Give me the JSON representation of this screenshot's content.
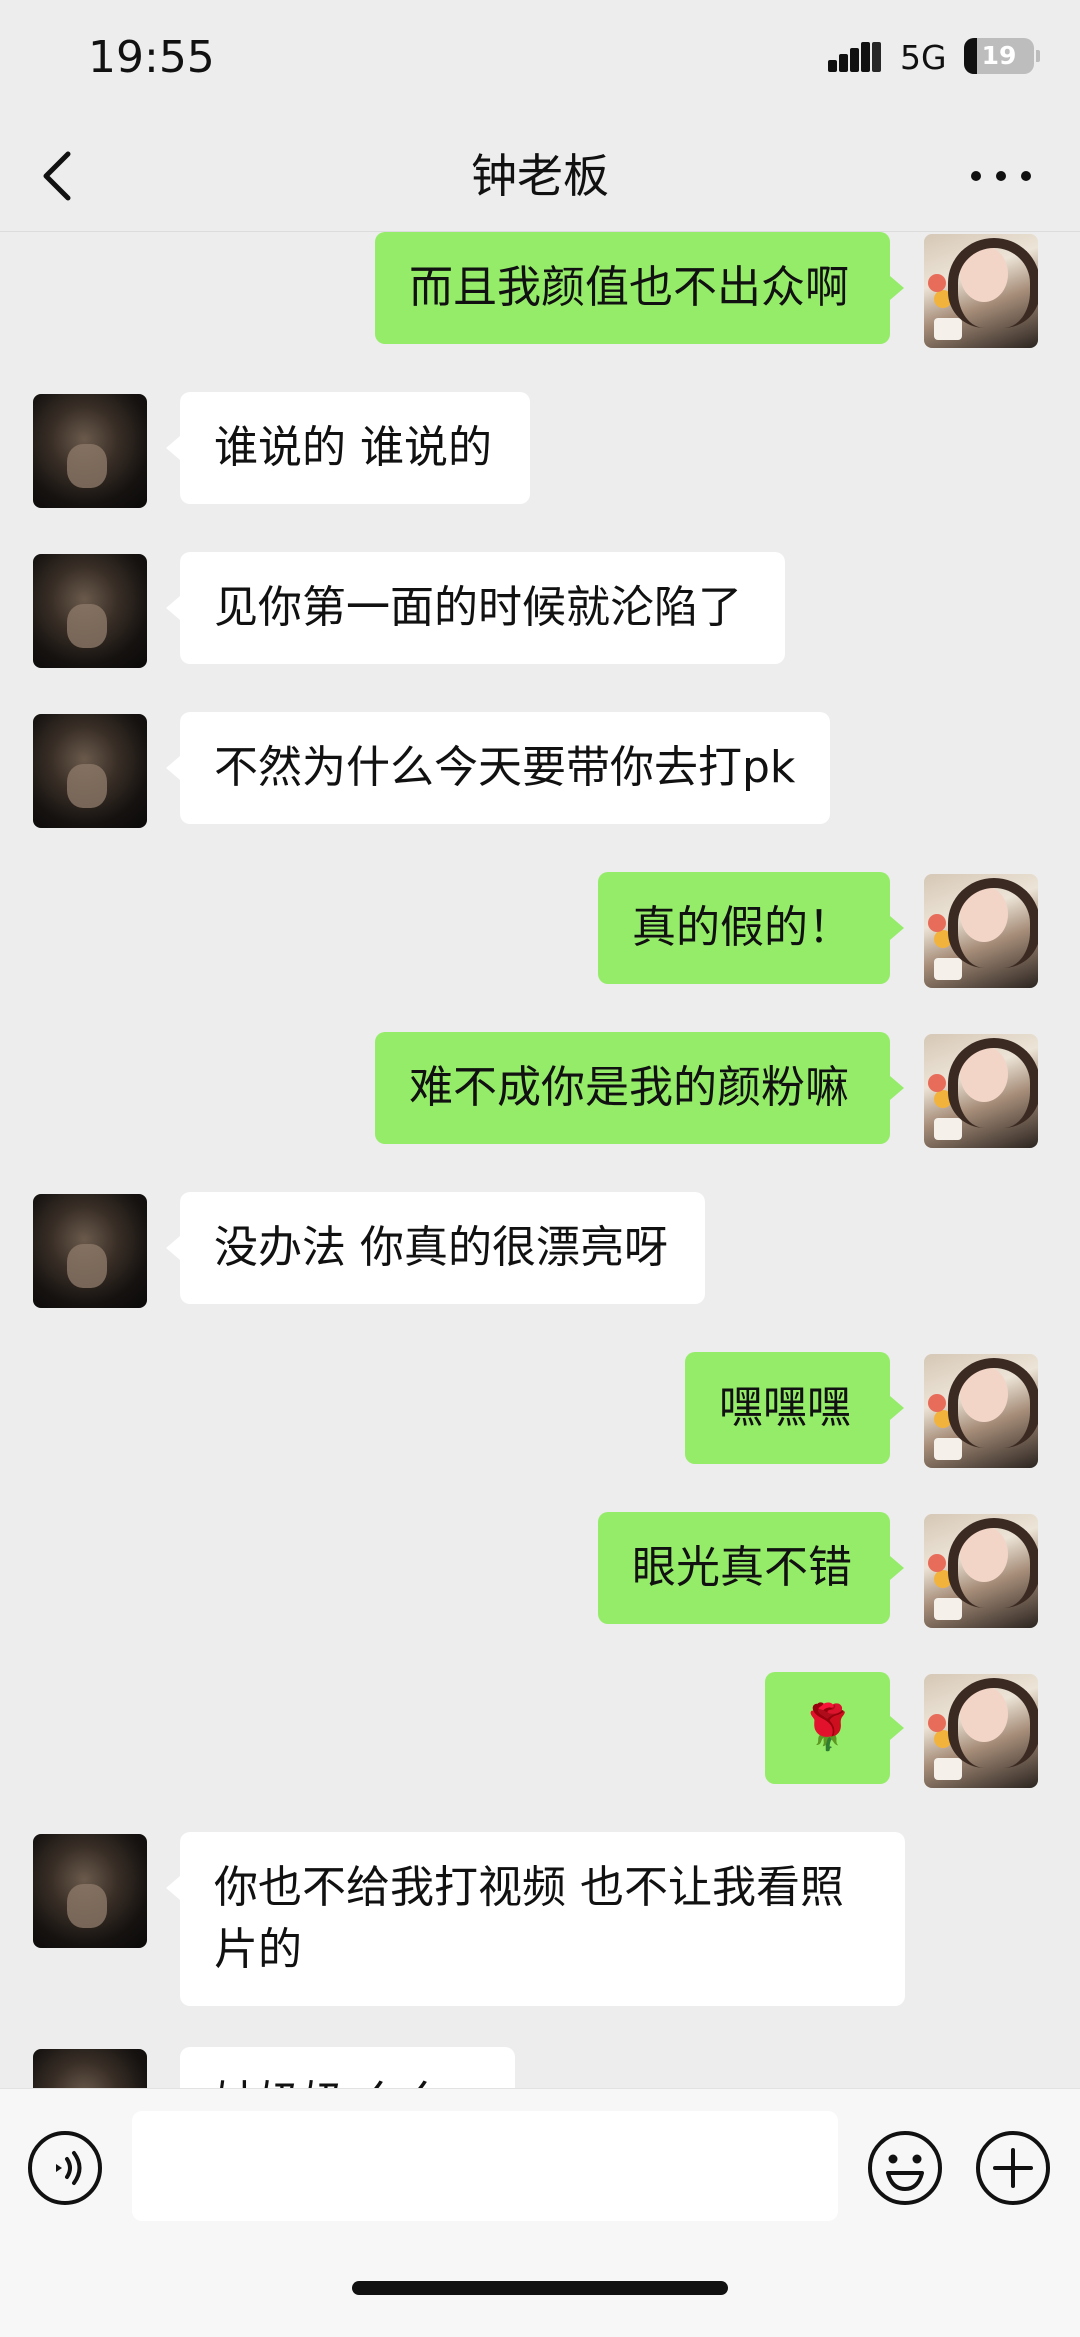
{
  "status_bar": {
    "time": "19:55",
    "network": "5G",
    "battery": "19",
    "battery_fraction": 0.19
  },
  "header": {
    "title": "钟老板",
    "back_icon": "chevron-left-icon",
    "more_icon": "more-dots-icon"
  },
  "messages": [
    {
      "sender": "me",
      "text": "而且我颜值也不出众啊"
    },
    {
      "sender": "other",
      "text": "谁说的 谁说的"
    },
    {
      "sender": "other",
      "text": "见你第一面的时候就沦陷了"
    },
    {
      "sender": "other",
      "text": "不然为什么今天要带你去打pk"
    },
    {
      "sender": "me",
      "text": "真的假的！"
    },
    {
      "sender": "me",
      "text": "难不成你是我的颜粉嘛"
    },
    {
      "sender": "other",
      "text": "没办法 你真的很漂亮呀"
    },
    {
      "sender": "me",
      "text": "嘿嘿嘿"
    },
    {
      "sender": "me",
      "text": "眼光真不错"
    },
    {
      "sender": "me",
      "text": "🌹"
    },
    {
      "sender": "other",
      "text": "你也不给我打视频 也不让我看照\n片的"
    },
    {
      "sender": "other",
      "text": "姑奶奶 么么哒"
    }
  ],
  "input_bar": {
    "value": "",
    "icons": [
      "voice-icon",
      "emoji-icon",
      "plus-icon"
    ]
  },
  "colors": {
    "background": "#ededed",
    "my_bubble": "#95ec69",
    "other_bubble": "#ffffff"
  }
}
